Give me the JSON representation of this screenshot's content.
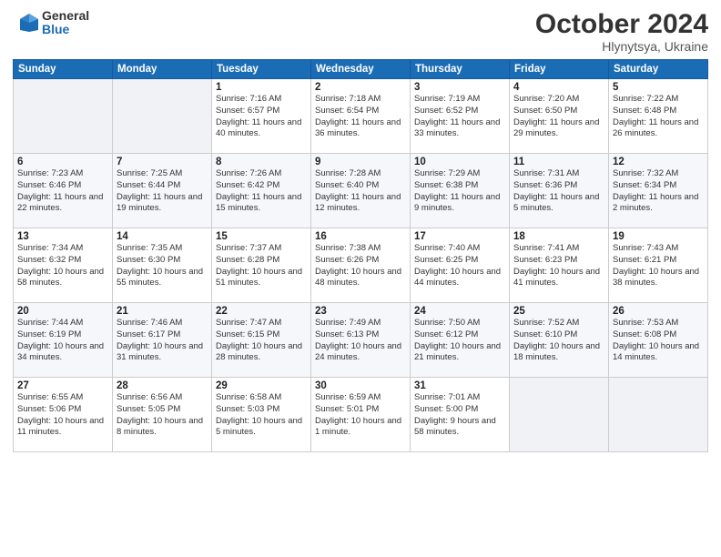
{
  "logo": {
    "general": "General",
    "blue": "Blue"
  },
  "title": {
    "month": "October 2024",
    "location": "Hlynytsya, Ukraine"
  },
  "weekdays": [
    "Sunday",
    "Monday",
    "Tuesday",
    "Wednesday",
    "Thursday",
    "Friday",
    "Saturday"
  ],
  "weeks": [
    [
      {
        "num": "",
        "info": ""
      },
      {
        "num": "",
        "info": ""
      },
      {
        "num": "1",
        "info": "Sunrise: 7:16 AM\nSunset: 6:57 PM\nDaylight: 11 hours and 40 minutes."
      },
      {
        "num": "2",
        "info": "Sunrise: 7:18 AM\nSunset: 6:54 PM\nDaylight: 11 hours and 36 minutes."
      },
      {
        "num": "3",
        "info": "Sunrise: 7:19 AM\nSunset: 6:52 PM\nDaylight: 11 hours and 33 minutes."
      },
      {
        "num": "4",
        "info": "Sunrise: 7:20 AM\nSunset: 6:50 PM\nDaylight: 11 hours and 29 minutes."
      },
      {
        "num": "5",
        "info": "Sunrise: 7:22 AM\nSunset: 6:48 PM\nDaylight: 11 hours and 26 minutes."
      }
    ],
    [
      {
        "num": "6",
        "info": "Sunrise: 7:23 AM\nSunset: 6:46 PM\nDaylight: 11 hours and 22 minutes."
      },
      {
        "num": "7",
        "info": "Sunrise: 7:25 AM\nSunset: 6:44 PM\nDaylight: 11 hours and 19 minutes."
      },
      {
        "num": "8",
        "info": "Sunrise: 7:26 AM\nSunset: 6:42 PM\nDaylight: 11 hours and 15 minutes."
      },
      {
        "num": "9",
        "info": "Sunrise: 7:28 AM\nSunset: 6:40 PM\nDaylight: 11 hours and 12 minutes."
      },
      {
        "num": "10",
        "info": "Sunrise: 7:29 AM\nSunset: 6:38 PM\nDaylight: 11 hours and 9 minutes."
      },
      {
        "num": "11",
        "info": "Sunrise: 7:31 AM\nSunset: 6:36 PM\nDaylight: 11 hours and 5 minutes."
      },
      {
        "num": "12",
        "info": "Sunrise: 7:32 AM\nSunset: 6:34 PM\nDaylight: 11 hours and 2 minutes."
      }
    ],
    [
      {
        "num": "13",
        "info": "Sunrise: 7:34 AM\nSunset: 6:32 PM\nDaylight: 10 hours and 58 minutes."
      },
      {
        "num": "14",
        "info": "Sunrise: 7:35 AM\nSunset: 6:30 PM\nDaylight: 10 hours and 55 minutes."
      },
      {
        "num": "15",
        "info": "Sunrise: 7:37 AM\nSunset: 6:28 PM\nDaylight: 10 hours and 51 minutes."
      },
      {
        "num": "16",
        "info": "Sunrise: 7:38 AM\nSunset: 6:26 PM\nDaylight: 10 hours and 48 minutes."
      },
      {
        "num": "17",
        "info": "Sunrise: 7:40 AM\nSunset: 6:25 PM\nDaylight: 10 hours and 44 minutes."
      },
      {
        "num": "18",
        "info": "Sunrise: 7:41 AM\nSunset: 6:23 PM\nDaylight: 10 hours and 41 minutes."
      },
      {
        "num": "19",
        "info": "Sunrise: 7:43 AM\nSunset: 6:21 PM\nDaylight: 10 hours and 38 minutes."
      }
    ],
    [
      {
        "num": "20",
        "info": "Sunrise: 7:44 AM\nSunset: 6:19 PM\nDaylight: 10 hours and 34 minutes."
      },
      {
        "num": "21",
        "info": "Sunrise: 7:46 AM\nSunset: 6:17 PM\nDaylight: 10 hours and 31 minutes."
      },
      {
        "num": "22",
        "info": "Sunrise: 7:47 AM\nSunset: 6:15 PM\nDaylight: 10 hours and 28 minutes."
      },
      {
        "num": "23",
        "info": "Sunrise: 7:49 AM\nSunset: 6:13 PM\nDaylight: 10 hours and 24 minutes."
      },
      {
        "num": "24",
        "info": "Sunrise: 7:50 AM\nSunset: 6:12 PM\nDaylight: 10 hours and 21 minutes."
      },
      {
        "num": "25",
        "info": "Sunrise: 7:52 AM\nSunset: 6:10 PM\nDaylight: 10 hours and 18 minutes."
      },
      {
        "num": "26",
        "info": "Sunrise: 7:53 AM\nSunset: 6:08 PM\nDaylight: 10 hours and 14 minutes."
      }
    ],
    [
      {
        "num": "27",
        "info": "Sunrise: 6:55 AM\nSunset: 5:06 PM\nDaylight: 10 hours and 11 minutes."
      },
      {
        "num": "28",
        "info": "Sunrise: 6:56 AM\nSunset: 5:05 PM\nDaylight: 10 hours and 8 minutes."
      },
      {
        "num": "29",
        "info": "Sunrise: 6:58 AM\nSunset: 5:03 PM\nDaylight: 10 hours and 5 minutes."
      },
      {
        "num": "30",
        "info": "Sunrise: 6:59 AM\nSunset: 5:01 PM\nDaylight: 10 hours and 1 minute."
      },
      {
        "num": "31",
        "info": "Sunrise: 7:01 AM\nSunset: 5:00 PM\nDaylight: 9 hours and 58 minutes."
      },
      {
        "num": "",
        "info": ""
      },
      {
        "num": "",
        "info": ""
      }
    ]
  ]
}
